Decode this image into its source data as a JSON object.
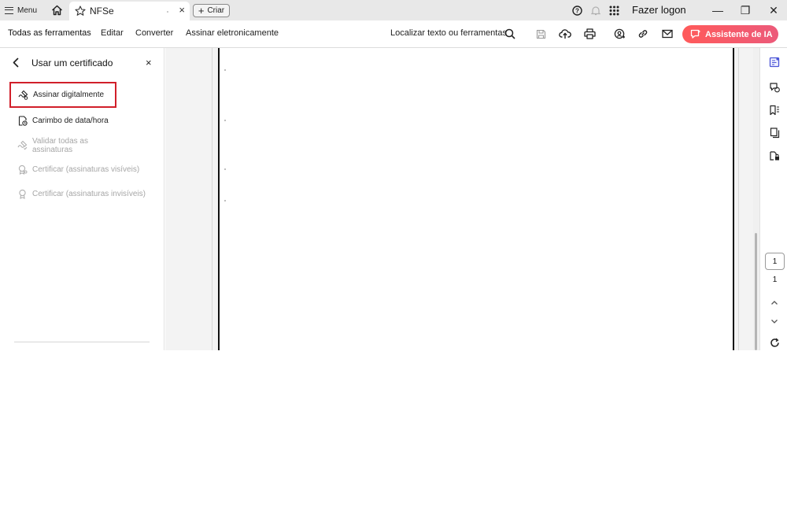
{
  "titlebar": {
    "menu_label": "Menu",
    "tab_name": "NFSe",
    "tab_close": "×",
    "create_label": "Criar",
    "login_label": "Fazer logon",
    "icons": [
      "home-icon",
      "star-icon",
      "help-icon",
      "bell-icon",
      "apps-grid-icon"
    ],
    "window_controls": {
      "minimize": "—",
      "restore": "❐",
      "close": "✕"
    }
  },
  "toolbar": {
    "tabs": [
      {
        "label": "Todas as ferramentas",
        "active": true
      },
      {
        "label": "Editar"
      },
      {
        "label": "Converter"
      },
      {
        "label": "Assinar eletronicamente"
      }
    ],
    "search_label": "Localizar texto ou ferramentas",
    "icons": [
      "search-icon",
      "save-icon",
      "upload-cloud-icon",
      "print-icon",
      "share-user-icon",
      "link-icon",
      "email-icon"
    ],
    "ai_button_label": "Assistente de IA",
    "ai_color": "#f45b69"
  },
  "panel": {
    "title": "Usar um certificado",
    "close": "×",
    "items": [
      {
        "label": "Assinar digitalmente",
        "enabled": true,
        "highlighted": true,
        "icon": "sign-pen-icon"
      },
      {
        "label": "Carimbo de data/hora",
        "enabled": true,
        "icon": "timestamp-icon"
      },
      {
        "label": "Validar todas as assinaturas",
        "enabled": false,
        "icon": "validate-signature-icon"
      },
      {
        "label": "Certificar (assinaturas visíveis)",
        "enabled": false,
        "icon": "certify-visible-icon"
      },
      {
        "label": "Certificar (assinaturas invisíveis)",
        "enabled": false,
        "icon": "certify-invisible-icon"
      }
    ],
    "highlight_color": "#d11f2a"
  },
  "navigation": {
    "current_page": "1",
    "total_pages": "1"
  },
  "right_rail": {
    "icons": [
      "edit-pdf-icon",
      "comment-icon",
      "bookmark-list-icon",
      "pages-icon",
      "protect-icon",
      "chevron-up-icon",
      "chevron-down-icon",
      "refresh-icon"
    ]
  }
}
